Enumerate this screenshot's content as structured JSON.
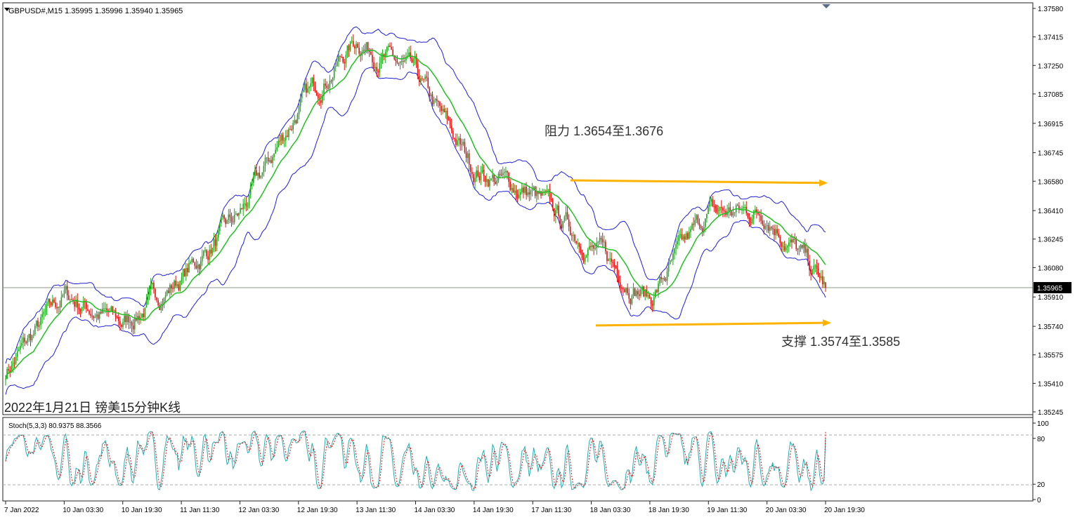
{
  "window": {
    "symbol_header": "GBPUSD#,M15  1.35995 1.35996 1.35940 1.35965"
  },
  "main_chart": {
    "caption": "2022年1月21日 镑美15分钟K线",
    "resistance_label": "阻力 1.3654至1.3676",
    "support_label": "支撑 1.3574至1.3585",
    "current_price": "1.35965",
    "price_ticks": [
      "1.37580",
      "1.37415",
      "1.37250",
      "1.37085",
      "1.36915",
      "1.36745",
      "1.36580",
      "1.36410",
      "1.36245",
      "1.36080",
      "1.35910",
      "1.35740",
      "1.35575",
      "1.35410",
      "1.35245"
    ]
  },
  "stoch_panel": {
    "label": "Stoch(5,3,3) 80.9375 88.3566",
    "ticks": [
      "100",
      "80",
      "20",
      "0"
    ]
  },
  "time_axis": {
    "labels": [
      "7 Jan 2022",
      "10 Jan 03:30",
      "10 Jan 19:30",
      "11 Jan 11:30",
      "12 Jan 03:30",
      "12 Jan 19:30",
      "13 Jan 11:30",
      "14 Jan 03:30",
      "14 Jan 19:30",
      "17 Jan 11:30",
      "18 Jan 03:30",
      "18 Jan 19:30",
      "19 Jan 11:30",
      "20 Jan 03:30",
      "20 Jan 19:30"
    ]
  },
  "colors": {
    "bull_candle": "#1aa81a",
    "bear_candle": "#e01010",
    "bands": "#1f1fd8",
    "ma_line": "#22c022",
    "level_arrows": "#ffb300",
    "stoch_main": "#20b0b0",
    "stoch_signal": "#e01010"
  },
  "chart_data": {
    "type": "candlestick",
    "symbol": "GBPUSD#",
    "timeframe": "M15",
    "last_bar": {
      "open": 1.35995,
      "high": 1.35996,
      "low": 1.3594,
      "close": 1.35965
    },
    "ylim": [
      1.35245,
      1.3758
    ],
    "price_path": {
      "x": [
        "7 Jan 2022",
        "10 Jan 03:30",
        "10 Jan 19:30",
        "11 Jan 11:30",
        "12 Jan 03:30",
        "12 Jan 19:30",
        "13 Jan 11:30",
        "14 Jan 03:30",
        "14 Jan 19:30",
        "17 Jan 11:30",
        "18 Jan 03:30",
        "18 Jan 19:30",
        "19 Jan 11:30",
        "20 Jan 03:30",
        "20 Jan 19:30"
      ],
      "y": [
        1.3548,
        1.3592,
        1.3575,
        1.3602,
        1.3638,
        1.37,
        1.374,
        1.3718,
        1.3665,
        1.365,
        1.362,
        1.359,
        1.364,
        1.364,
        1.3596
      ]
    },
    "resistance_zone": [
      1.3654,
      1.3676
    ],
    "support_zone": [
      1.3574,
      1.3585
    ],
    "stochastic": {
      "k_period": 5,
      "d_period": 3,
      "slowing": 3,
      "main": 80.9375,
      "signal": 88.3566,
      "levels": [
        80,
        20
      ],
      "ylim": [
        0,
        100
      ]
    }
  }
}
